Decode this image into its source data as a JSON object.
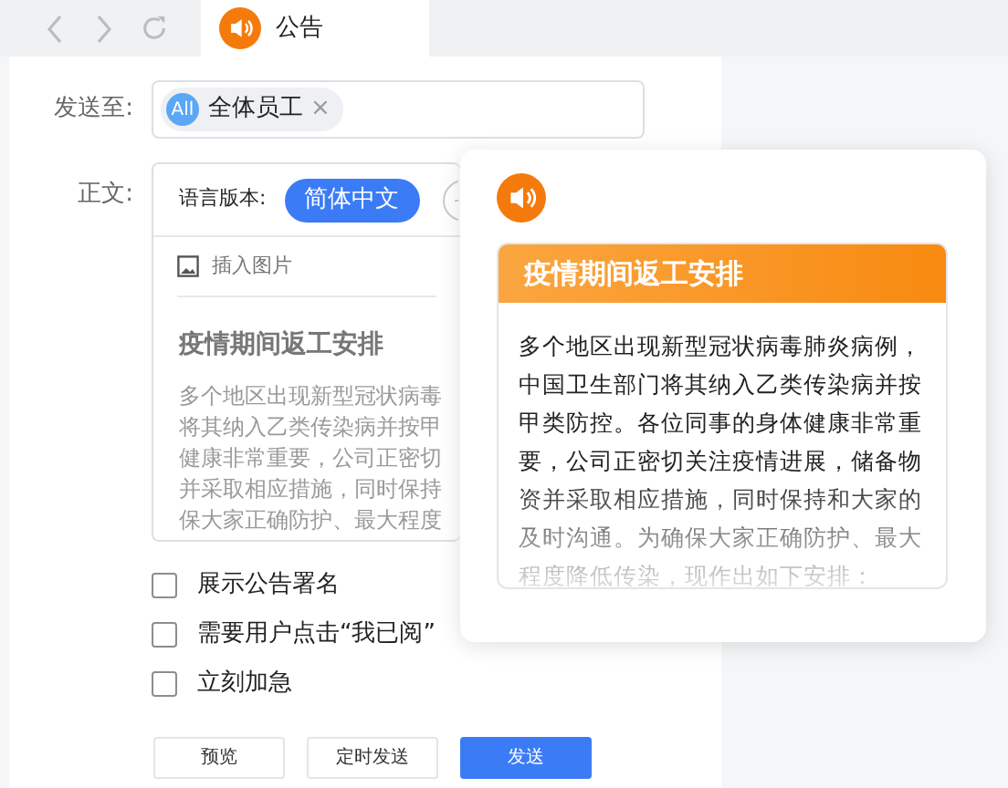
{
  "tab": {
    "title": "公告",
    "selected": true
  },
  "form": {
    "recipient_label": "发送至:",
    "recipients": [
      {
        "avatar": "All",
        "name": "全体员工",
        "remove": "×"
      }
    ],
    "body_label": "正文:",
    "language_label": "语言版本:",
    "languages": [
      {
        "label": "简体中文",
        "selected": true
      }
    ],
    "insert_image": "插入图片",
    "editor_title": "疫情期间返工安排",
    "editor_lines": [
      "多个地区出现新型冠状病毒",
      "将其纳入乙类传染病并按甲",
      "健康非常重要，公司正密切",
      "并采取相应措施，同时保持",
      "保大家正确防护、最大程度"
    ],
    "options": [
      {
        "label": "展示公告署名",
        "checked": false
      },
      {
        "label": "需要用户点击“我已阅”",
        "checked": false
      },
      {
        "label": "立刻加急",
        "checked": false
      }
    ],
    "buttons": [
      {
        "label": "预览",
        "kind": "plain"
      },
      {
        "label": "定时发送",
        "kind": "plain"
      },
      {
        "label": "发送",
        "kind": "primary"
      }
    ]
  },
  "preview": {
    "title": "疫情期间返工安排",
    "body": "多个地区出现新型冠状病毒肺炎病例，中国卫生部门将其纳入乙类传染病并按甲类防控。各位同事的身体健康非常重要，公司正密切关注疫情进展，储备物资并采取相应措施，同时保持和大家的及时沟通。为确保大家正确防护、最大程度降低传染，现作出如下安排："
  }
}
